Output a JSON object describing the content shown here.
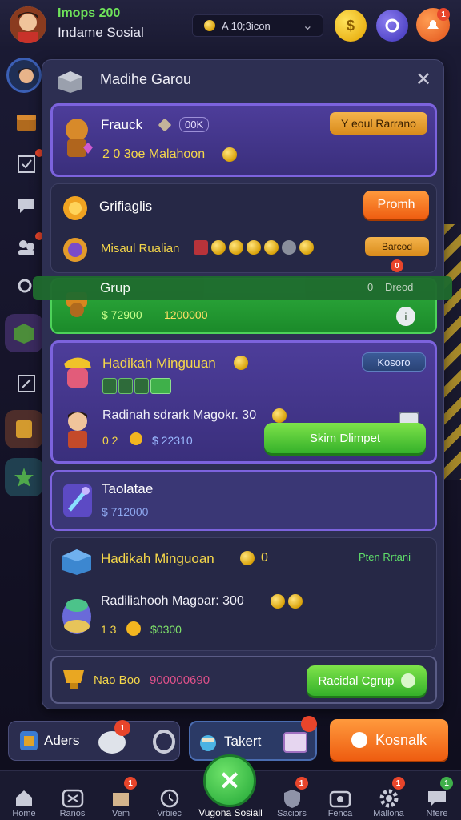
{
  "header": {
    "level_text": "Imops 200",
    "subtitle": "Indame Sosial",
    "currency_text": "A 10;3icon",
    "currency_chevron": "⌄"
  },
  "panel": {
    "title": "Madihe Garou",
    "close_symbol": "✕"
  },
  "cards": [
    {
      "title": "Frauck",
      "tag": "00K",
      "value": "2 0 3oe Malahoon",
      "button": "Y eoul Rarrano"
    },
    {
      "title": "Grifiaglis",
      "button": "Promh",
      "row_label": "Misaul Rualian",
      "side_button": "Barcod",
      "side_badge": "0"
    },
    {
      "title": "Grup",
      "right_text": "Dreod",
      "right_prefix": "0",
      "value_a": "$ 72900",
      "value_b": "1200000"
    },
    {
      "title": "Hadikah Minguuan",
      "tag_button": "Kosoro",
      "row2_label": "Radinah sdrark Magokr. 30",
      "value_a": "0 2",
      "value_b": "$ 22310",
      "button": "Skim Dlimpet"
    },
    {
      "title": "Taolatae",
      "value": "$ 712000"
    },
    {
      "title": "Hadikah Minguoan",
      "title_suffix": "0",
      "right_text": "Pten Rrtani",
      "row2_label": "Radiliahooh Magoar: 300",
      "value_a": "1 3",
      "value_b": "$0300"
    },
    {
      "title": "Nao Boo",
      "highlight": "900000690",
      "button": "Racidal Cgrup"
    }
  ],
  "bottom_buttons": {
    "left_label": "Aders",
    "left_badge": "1",
    "mid_label": "Takert",
    "right_label": "Kosnalk"
  },
  "nav": [
    {
      "label": "Home",
      "icon": "home-icon"
    },
    {
      "label": "Ranos",
      "icon": "gamepad-icon"
    },
    {
      "label": "Vem",
      "icon": "box-icon",
      "badge": "1"
    },
    {
      "label": "Vrbiec",
      "icon": "clock-icon"
    },
    {
      "label": "Vugona Sosiall",
      "icon": "close-icon"
    },
    {
      "label": "Saciors",
      "icon": "shield-icon",
      "badge": "1"
    },
    {
      "label": "Fenca",
      "icon": "camera-icon"
    },
    {
      "label": "Mallona",
      "icon": "gear-icon",
      "badge": "1"
    },
    {
      "label": "Nfere",
      "icon": "chat-icon",
      "badge": "1"
    }
  ],
  "colors": {
    "accent_orange": "#f26a1b",
    "accent_green": "#35b12a",
    "card_purple": "#7c63dd",
    "gold": "#f5d74a"
  }
}
